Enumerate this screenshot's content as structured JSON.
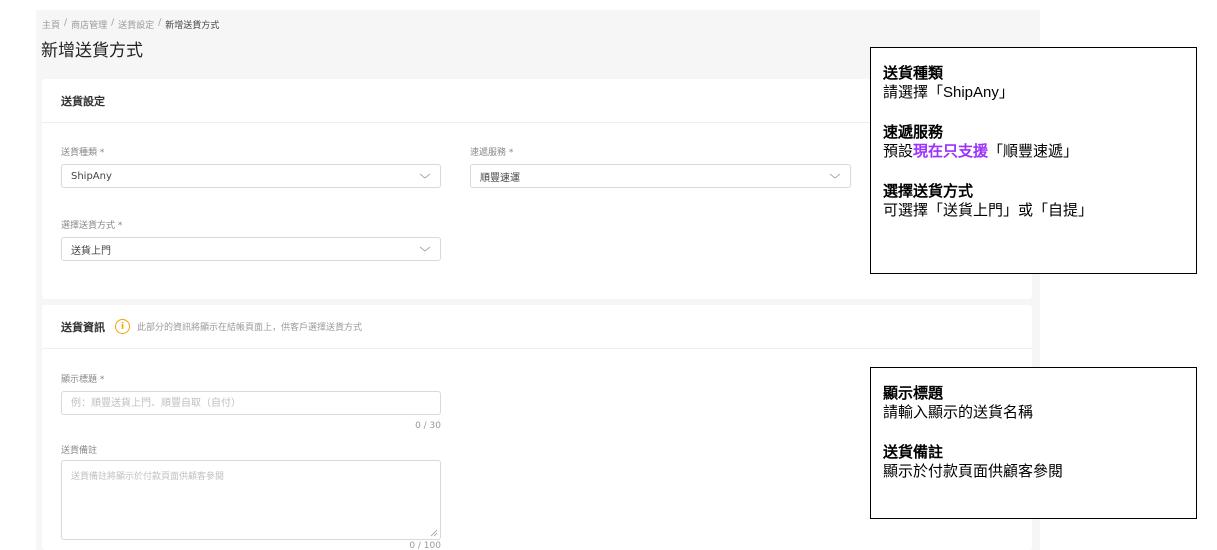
{
  "breadcrumb": {
    "items": [
      "主頁",
      "商店管理",
      "送貨設定"
    ],
    "separator": "/",
    "current": "新增送貨方式"
  },
  "page_title": "新增送貨方式",
  "shipping_settings": {
    "header": "送貨設定",
    "shipping_type": {
      "label": "送貨種類 *",
      "value": "ShipAny"
    },
    "courier_service": {
      "label": "速遞服務 *",
      "value": "順豐速運"
    },
    "delivery_method": {
      "label": "選擇送貨方式 *",
      "value": "送貨上門"
    }
  },
  "shipping_info": {
    "header": "送貨資訊",
    "info_icon": "info-circle-icon",
    "hint": "此部分的資訊將顯示在結帳頁面上，供客戶選擇送貨方式",
    "display_title": {
      "label": "顯示標題 *",
      "placeholder": "例：順豐送貨上門、順豐自取（自付）",
      "counter": "0 / 30"
    },
    "remark": {
      "label": "送貨備註",
      "placeholder": "送貨備註將顯示於付款頁面供顧客參閱",
      "counter": "0 / 100"
    }
  },
  "note_top": {
    "t1": "送貨種類",
    "d1": "請選擇「ShipAny」",
    "t2": "速遞服務",
    "d2_pre": "預設",
    "d2_highlight": "現在只支援",
    "d2_post": "「順豐速遞」",
    "t3": "選擇送貨方式",
    "d3": "可選擇「送貨上門」或「自提」"
  },
  "note_bottom": {
    "t1": "顯示標題",
    "d1": "請輸入顯示的送貨名稱",
    "t2": "送貨備註",
    "d2": "顯示於付款頁面供顧客參閱"
  },
  "colors": {
    "highlight": "#9b30ff",
    "info_icon": "#f0a500",
    "page_bg": "#f6f6f6"
  }
}
